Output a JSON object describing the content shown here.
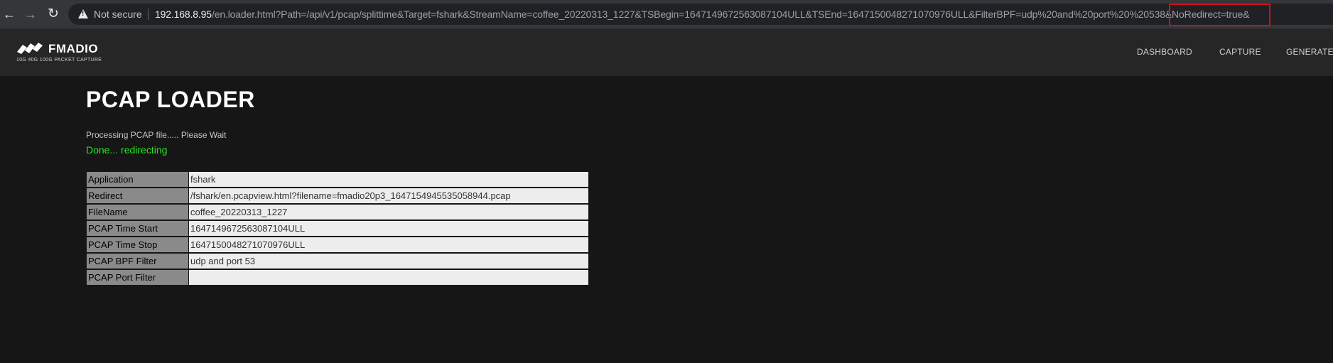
{
  "browser": {
    "security_label": "Not secure",
    "url_host": "192.168.8.95",
    "url_path": "/en.loader.html?Path=/api/v1/pcap/splittime&Target=fshark&StreamName=coffee_20220313_1227&TSBegin=1647149672563087104ULL&TSEnd=1647150048271070976ULL&FilterBPF=udp%20and%20port%20%20538",
    "url_highlighted": "&NoRedirect=true&"
  },
  "nav": {
    "logo_text": "FMADIO",
    "logo_subtitle": "10G 40G 100G  PACKET CAPTURE",
    "links": [
      "DASHBOARD",
      "CAPTURE",
      "GENERATE"
    ]
  },
  "page": {
    "title": "PCAP LOADER",
    "processing_text": "Processing PCAP file..... Please Wait",
    "status_text": "Done... redirecting"
  },
  "info_table": [
    {
      "key": "Application",
      "value": "fshark"
    },
    {
      "key": "Redirect",
      "value": "/fshark/en.pcapview.html?filename=fmadio20p3_1647154945535058944.pcap"
    },
    {
      "key": "FileName",
      "value": "coffee_20220313_1227"
    },
    {
      "key": "PCAP Time Start",
      "value": "1647149672563087104ULL"
    },
    {
      "key": "PCAP Time Stop",
      "value": "1647150048271070976ULL"
    },
    {
      "key": "PCAP BPF Filter",
      "value": "udp and port  53"
    },
    {
      "key": "PCAP Port Filter",
      "value": ""
    }
  ],
  "colors": {
    "status_green": "#22e822",
    "highlight_red": "#d0101a",
    "background": "#161616"
  }
}
